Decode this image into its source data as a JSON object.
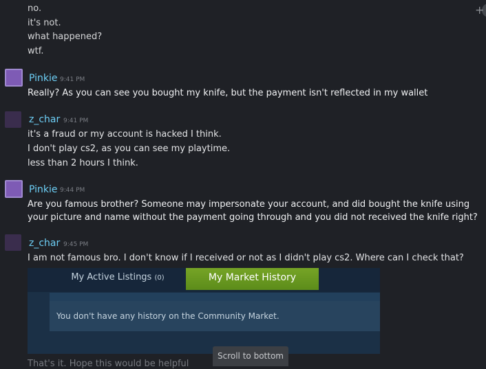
{
  "top_lines": [
    "no.",
    "it's not.",
    "what happened?",
    "wtf."
  ],
  "messages": [
    {
      "author": "Pinkie",
      "time": "9:41 PM",
      "lines": [
        "Really? As you can see you bought my knife, but the payment isn't reflected in my wallet"
      ]
    },
    {
      "author": "z_char",
      "time": "9:41 PM",
      "lines": [
        "it's a fraud or my account is hacked I think.",
        "I don't play cs2, as you can see my playtime.",
        "less than 2 hours I think."
      ]
    },
    {
      "author": "Pinkie",
      "time": "9:44 PM",
      "lines": [
        "Are you famous brother? Someone may impersonate your account, and did bought the knife using",
        "your picture and name without the payment going through and you did not received the knife right?"
      ]
    },
    {
      "author": "z_char",
      "time": "9:45 PM",
      "lines": [
        "I am not famous bro. I don't know if I received or not as I didn't play cs2. Where can I check that?"
      ]
    }
  ],
  "embed": {
    "tab_active_listings": "My Active Listings",
    "tab_active_count": "(0)",
    "tab_market_history": "My Market History",
    "notice": "You don't have any history on the Community Market."
  },
  "scroll_button": "Scroll to bottom",
  "partial_text": "That's it. Hope this would be helpful",
  "colors": {
    "username": "#6dcff6",
    "active_tab": "#5c8c1a",
    "background": "#1f2126"
  }
}
